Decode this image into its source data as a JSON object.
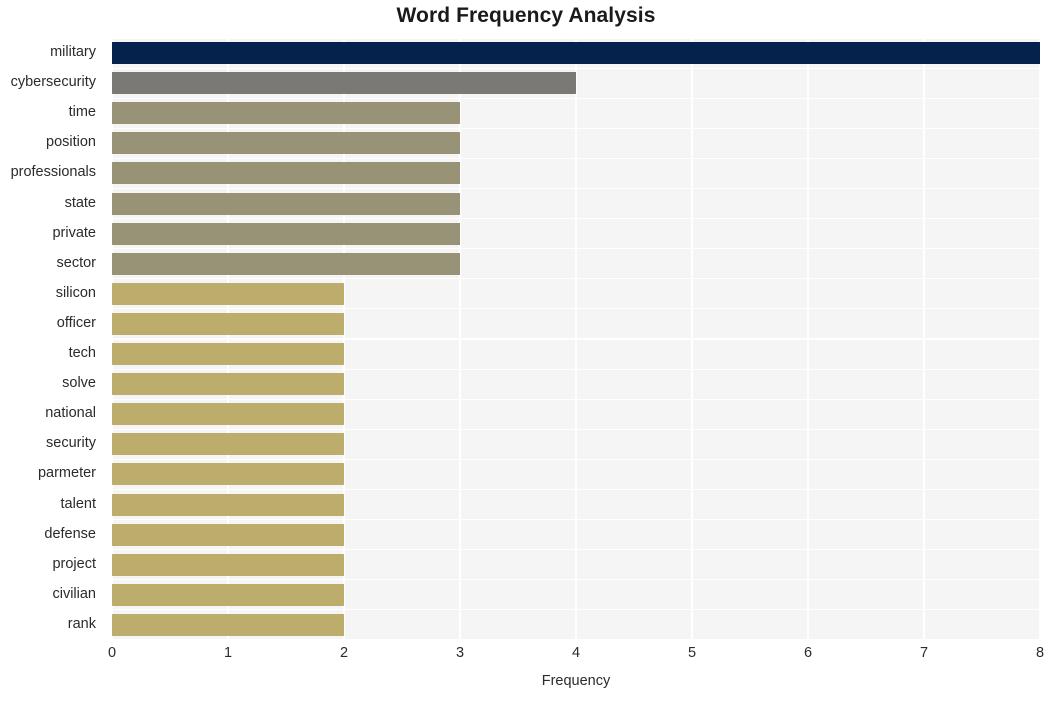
{
  "chart_data": {
    "type": "bar",
    "orientation": "horizontal",
    "title": "Word Frequency Analysis",
    "xlabel": "Frequency",
    "ylabel": "",
    "xlim": [
      0,
      8
    ],
    "xticks": [
      0,
      1,
      2,
      3,
      4,
      5,
      6,
      7,
      8
    ],
    "xtick_labels": [
      "0",
      "1",
      "2",
      "3",
      "4",
      "5",
      "6",
      "7",
      "8"
    ],
    "grid": true,
    "legend": "none",
    "categories": [
      "military",
      "cybersecurity",
      "time",
      "position",
      "professionals",
      "state",
      "private",
      "sector",
      "silicon",
      "officer",
      "tech",
      "solve",
      "national",
      "security",
      "parmeter",
      "talent",
      "defense",
      "project",
      "civilian",
      "rank"
    ],
    "values": [
      8,
      4,
      3,
      3,
      3,
      3,
      3,
      3,
      2,
      2,
      2,
      2,
      2,
      2,
      2,
      2,
      2,
      2,
      2,
      2
    ],
    "bar_colors": [
      "#04224c",
      "#7b7976",
      "#989276",
      "#989276",
      "#989276",
      "#989276",
      "#989276",
      "#989276",
      "#bcad6d",
      "#bcad6d",
      "#bcad6d",
      "#bcad6d",
      "#bcad6d",
      "#bcad6d",
      "#bcad6d",
      "#bcad6d",
      "#bcad6d",
      "#bcad6d",
      "#bcad6d",
      "#bcad6d"
    ]
  },
  "style": {
    "plot_background": "#f5f5f6",
    "grid_color": "#ffffff",
    "figure_background": "#ffffff",
    "text_color": "#2b2b2b",
    "title_color": "#1a1a1a"
  }
}
